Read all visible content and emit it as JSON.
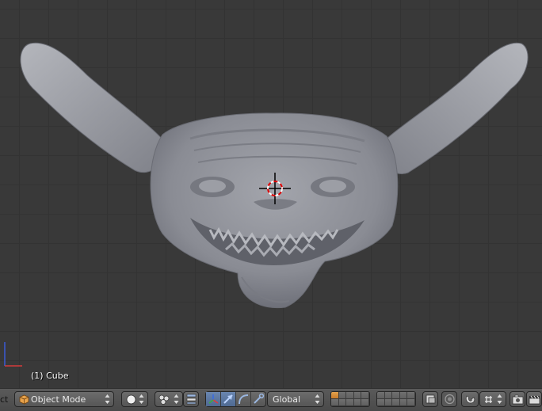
{
  "viewport": {
    "object_label": "(1) Cube",
    "background_color": "#393939",
    "grid_color": "#333333",
    "model_color": "#8e9097"
  },
  "header": {
    "menu_tail": "ct",
    "mode_dropdown": {
      "label": "Object Mode",
      "icon": "cube-icon"
    },
    "shading_dropdown": {
      "icon": "solid-sphere-icon"
    },
    "pivot_dropdown": {
      "icon": "pivot-point-icon"
    },
    "orientation_dropdown": {
      "label": "Global"
    },
    "accent_color": "#5680c2",
    "layer_active_color": "#e39d45"
  }
}
